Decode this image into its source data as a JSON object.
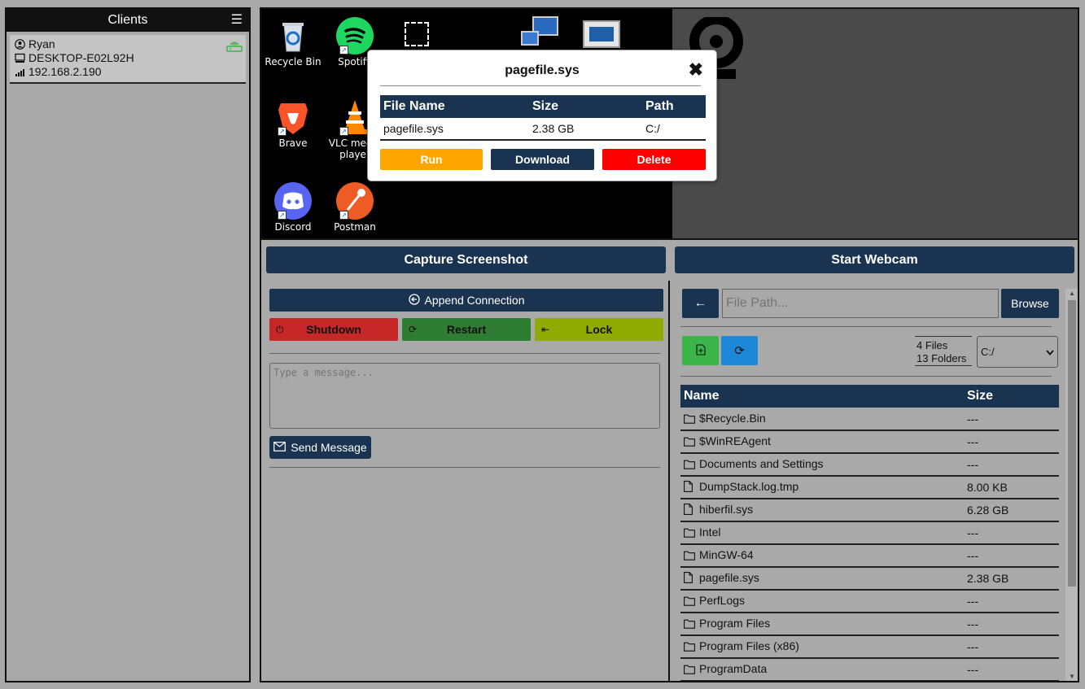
{
  "sidebar": {
    "title": "Clients",
    "client": {
      "name": "Ryan",
      "host": "DESKTOP-E02L92H",
      "ip": "192.168.2.190"
    }
  },
  "desktop_icons": [
    {
      "label": "Recycle Bin",
      "icon": "recycle-bin-icon"
    },
    {
      "label": "Spotify",
      "icon": "spotify-icon"
    },
    {
      "label": "Brave",
      "icon": "brave-icon"
    },
    {
      "label": "VLC media player",
      "icon": "vlc-icon"
    },
    {
      "label": "Discord",
      "icon": "discord-icon"
    },
    {
      "label": "Postman",
      "icon": "postman-icon"
    }
  ],
  "actions": {
    "capture": "Capture Screenshot",
    "webcam": "Start Webcam"
  },
  "power": {
    "append": "Append Connection",
    "shutdown": "Shutdown",
    "restart": "Restart",
    "lock": "Lock",
    "message_placeholder": "Type a message...",
    "send": "Send Message"
  },
  "files": {
    "path_placeholder": "File Path...",
    "browse": "Browse",
    "files_count": "4 Files",
    "folders_count": "13 Folders",
    "drive": "C:/",
    "columns": {
      "name": "Name",
      "size": "Size"
    },
    "rows": [
      {
        "name": "$Recycle.Bin",
        "size": "---",
        "type": "folder"
      },
      {
        "name": "$WinREAgent",
        "size": "---",
        "type": "folder"
      },
      {
        "name": "Documents and Settings",
        "size": "---",
        "type": "folder"
      },
      {
        "name": "DumpStack.log.tmp",
        "size": "8.00 KB",
        "type": "file"
      },
      {
        "name": "hiberfil.sys",
        "size": "6.28 GB",
        "type": "file"
      },
      {
        "name": "Intel",
        "size": "---",
        "type": "folder"
      },
      {
        "name": "MinGW-64",
        "size": "---",
        "type": "folder"
      },
      {
        "name": "pagefile.sys",
        "size": "2.38 GB",
        "type": "file"
      },
      {
        "name": "PerfLogs",
        "size": "---",
        "type": "folder"
      },
      {
        "name": "Program Files",
        "size": "---",
        "type": "folder"
      },
      {
        "name": "Program Files (x86)",
        "size": "---",
        "type": "folder"
      },
      {
        "name": "ProgramData",
        "size": "---",
        "type": "folder"
      }
    ]
  },
  "modal": {
    "title": "pagefile.sys",
    "headers": {
      "name": "File Name",
      "size": "Size",
      "path": "Path"
    },
    "file": {
      "name": "pagefile.sys",
      "size": "2.38 GB",
      "path": "C:/"
    },
    "run": "Run",
    "download": "Download",
    "delete": "Delete"
  },
  "colors": {
    "navy": "#1a3350",
    "shutdown": "#c62828",
    "restart": "#2e7d32",
    "lock": "#8faa00",
    "run": "#ffa500",
    "delete": "#ff0000",
    "online": "#3bb44a"
  }
}
